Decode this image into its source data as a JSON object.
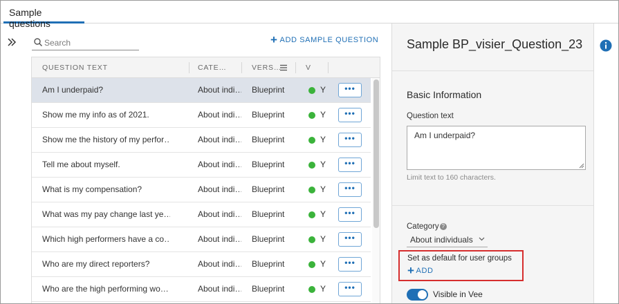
{
  "tabs": [
    {
      "label": "Sample questions"
    }
  ],
  "search": {
    "placeholder": "Search"
  },
  "toolbar": {
    "add_label": "ADD SAMPLE QUESTION"
  },
  "table": {
    "columns": [
      "QUESTION TEXT",
      "CATE…",
      "VERS…",
      "V"
    ],
    "rows": [
      {
        "question": "Am I underpaid?",
        "category": "About indi…",
        "version": "Blueprint",
        "v": "Y",
        "more": "•••"
      },
      {
        "question": "Show me my info as of 2021.",
        "category": "About indi…",
        "version": "Blueprint",
        "v": "Y",
        "more": "•••"
      },
      {
        "question": "Show me the history of my perfor…",
        "category": "About indi…",
        "version": "Blueprint",
        "v": "Y",
        "more": "•••"
      },
      {
        "question": "Tell me about myself.",
        "category": "About indi…",
        "version": "Blueprint",
        "v": "Y",
        "more": "•••"
      },
      {
        "question": "What is my compensation?",
        "category": "About indi…",
        "version": "Blueprint",
        "v": "Y",
        "more": "•••"
      },
      {
        "question": "What was my pay change last ye…",
        "category": "About indi…",
        "version": "Blueprint",
        "v": "Y",
        "more": "•••"
      },
      {
        "question": "Which high performers have a co…",
        "category": "About indi…",
        "version": "Blueprint",
        "v": "Y",
        "more": "•••"
      },
      {
        "question": "Who are my direct reporters?",
        "category": "About indi…",
        "version": "Blueprint",
        "v": "Y",
        "more": "•••"
      },
      {
        "question": "Who are the high performing wo…",
        "category": "About indi…",
        "version": "Blueprint",
        "v": "Y",
        "more": "•••"
      }
    ]
  },
  "panel": {
    "title": "Sample BP_visier_Question_23",
    "section": "Basic Information",
    "question_label": "Question text",
    "question_value": "Am I underpaid?",
    "hint": "Limit text to 160 characters.",
    "category_label": "Category",
    "category_value": "About individuals",
    "groups_label": "Set as default for user groups",
    "add_label": "ADD",
    "toggle_label": "Visible in Vee"
  },
  "colors": {
    "accent": "#1f6fb5",
    "status_green": "#3bb33b",
    "highlight": "#d62d2d"
  }
}
